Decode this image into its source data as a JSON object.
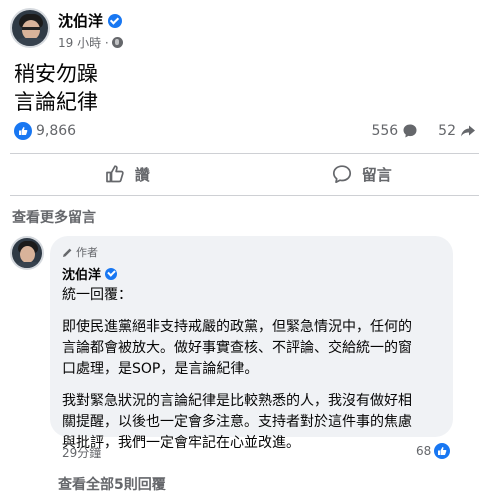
{
  "post": {
    "author": "沈伯洋",
    "time": "19 小時 ·",
    "lines": [
      "稍安勿躁",
      "言論紀律"
    ]
  },
  "stats": {
    "likes": "9,866",
    "comments": "556",
    "shares": "52"
  },
  "actions": {
    "like_label": "讚",
    "comment_label": "留言"
  },
  "comments_section": {
    "more_label": "查看更多留言",
    "comment": {
      "author_tag": "作者",
      "author": "沈伯洋",
      "para1": "統一回覆：",
      "para2_lines": [
        "即使民進黨絕非支持戒嚴的政黨，但緊急情況中，任何的",
        "言論都會被放大。做好事實查核、不評論、交給統一的窗",
        "口處理，是SOP，是言論紀律。"
      ],
      "para3_lines": [
        "我對緊急狀況的言論紀律是比較熟悉的人，我沒有做好相",
        "關提醒，以後也一定會多注意。支持者對於這件事的焦慮",
        "與批評，我們一定會牢記在心並改進。"
      ],
      "time": "29分鐘",
      "likes": "68"
    },
    "view_replies_label": "查看全部5則回覆"
  },
  "colors": {
    "accent": "#1877f2",
    "secondary_text": "#65676b",
    "bubble_bg": "#f0f2f5"
  }
}
